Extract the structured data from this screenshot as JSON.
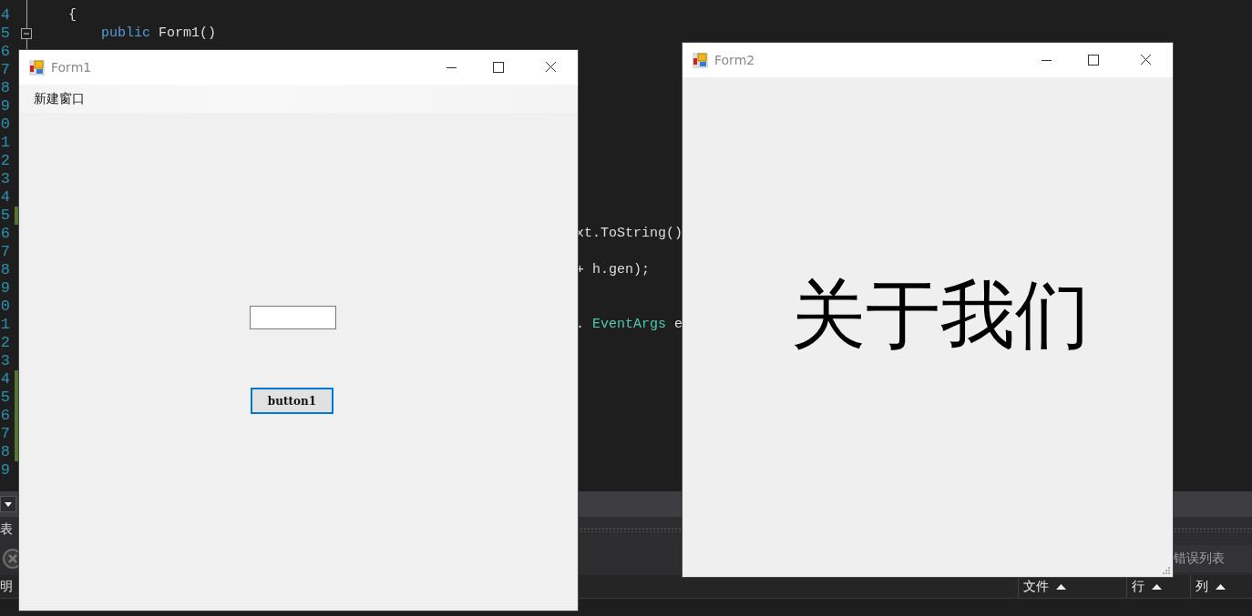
{
  "editor": {
    "lines": [
      {
        "number": "4",
        "changed": false,
        "tokens": [
          {
            "text": "    {",
            "kind": "plain"
          }
        ]
      },
      {
        "number": "5",
        "changed": false,
        "fold": true,
        "tokens": [
          {
            "text": "        public",
            "kind": "keyword"
          },
          {
            "text": " Form1()",
            "kind": "plain"
          }
        ]
      },
      {
        "number": "6",
        "changed": false
      },
      {
        "number": "7",
        "changed": false
      },
      {
        "number": "8",
        "changed": false
      },
      {
        "number": "9",
        "changed": false
      },
      {
        "number": "0",
        "changed": false
      },
      {
        "number": "1",
        "changed": false
      },
      {
        "number": "2",
        "changed": false
      },
      {
        "number": "3",
        "changed": false
      },
      {
        "number": "4",
        "changed": false
      },
      {
        "number": "5",
        "changed": true
      },
      {
        "number": "6",
        "changed": false,
        "tail": true,
        "tokens": [
          {
            "text": "xt.ToString()",
            "kind": "plain"
          }
        ]
      },
      {
        "number": "7",
        "changed": false
      },
      {
        "number": "8",
        "changed": false,
        "tail": true,
        "tokens": [
          {
            "text": "+ h.gen);",
            "kind": "plain"
          }
        ]
      },
      {
        "number": "9",
        "changed": false
      },
      {
        "number": "0",
        "changed": false
      },
      {
        "number": "1",
        "changed": false,
        "tail": true,
        "tokens": [
          {
            "text": ". ",
            "kind": "plain"
          },
          {
            "text": "EventArgs",
            "kind": "type"
          },
          {
            "text": " e",
            "kind": "plain"
          }
        ]
      },
      {
        "number": "2",
        "changed": false
      },
      {
        "number": "3",
        "changed": false
      },
      {
        "number": "4",
        "changed": true
      },
      {
        "number": "5",
        "changed": true
      },
      {
        "number": "6",
        "changed": true
      },
      {
        "number": "7",
        "changed": true
      },
      {
        "number": "8",
        "changed": true
      },
      {
        "number": "9",
        "changed": false
      }
    ]
  },
  "tool_window": {
    "tab_fragment": "表",
    "error_list_title": "错误列表",
    "footer_fragment": "明",
    "columns": [
      {
        "label": "文件"
      },
      {
        "label": "行"
      },
      {
        "label": "列"
      }
    ]
  },
  "form1": {
    "title": "Form1",
    "menu": [
      {
        "label": "新建窗口"
      }
    ],
    "button": {
      "label": "button1",
      "focused": true
    }
  },
  "form2": {
    "title": "Form2",
    "heading": "关于我们"
  }
}
